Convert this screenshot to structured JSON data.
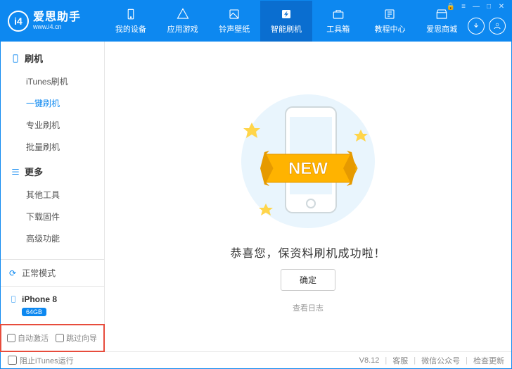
{
  "window_controls": {
    "lock": "🔒",
    "menu": "≡",
    "min": "—",
    "max": "□",
    "close": "✕"
  },
  "brand": {
    "badge": "i4",
    "title": "爱思助手",
    "url": "www.i4.cn"
  },
  "nav": {
    "items": [
      "我的设备",
      "应用游戏",
      "铃声壁纸",
      "智能刷机",
      "工具箱",
      "教程中心",
      "爱思商城"
    ],
    "activeIndex": 3
  },
  "sidebar": {
    "group1": {
      "title": "刷机",
      "items": [
        "iTunes刷机",
        "一键刷机",
        "专业刷机",
        "批量刷机"
      ],
      "activeIndex": 1
    },
    "group2": {
      "title": "更多",
      "items": [
        "其他工具",
        "下载固件",
        "高级功能"
      ]
    }
  },
  "status": {
    "mode": "正常模式"
  },
  "device": {
    "name": "iPhone 8",
    "capacity": "64GB"
  },
  "options": {
    "autoActivate": "自动激活",
    "skipGuide": "跳过向导"
  },
  "content": {
    "ribbon": "NEW",
    "success": "恭喜您，保资料刷机成功啦！",
    "ok": "确定",
    "viewLog": "查看日志"
  },
  "footer": {
    "blockItunes": "阻止iTunes运行",
    "version": "V8.12",
    "support": "客服",
    "wechat": "微信公众号",
    "checkUpdate": "检查更新"
  }
}
